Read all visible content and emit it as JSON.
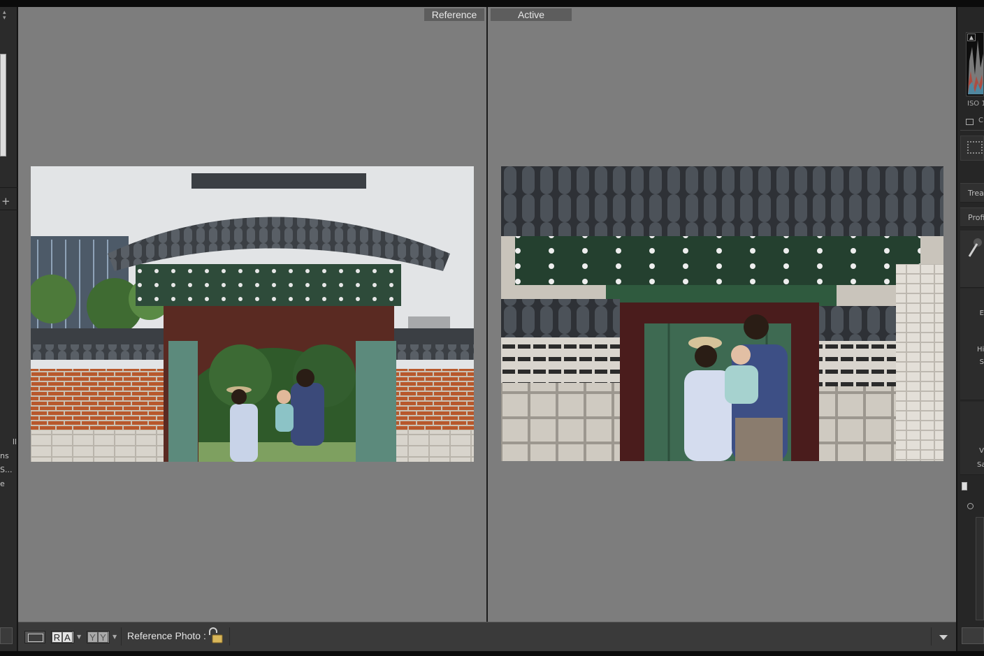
{
  "compare_view": {
    "reference_label": "Reference",
    "active_label": "Active"
  },
  "toolbar": {
    "reference_photo_label": "Reference Photo :",
    "ref_active_letters": [
      "R",
      "A"
    ],
    "yy_letters": [
      "Y",
      "Y"
    ]
  },
  "left_panel": {
    "labels": [
      "ll",
      "ns",
      "S...",
      "e"
    ]
  },
  "right_panel": {
    "iso_text": "ISO 1",
    "crop_label": "C",
    "rows": [
      "Trea",
      "Profi"
    ],
    "cut_labels": [
      "E",
      "Hi",
      "S",
      "V",
      "Sa"
    ]
  },
  "colors": {
    "canvas": "#7d7d7d",
    "panel": "#2b2b2b",
    "label_bg": "#5d5d5d"
  }
}
